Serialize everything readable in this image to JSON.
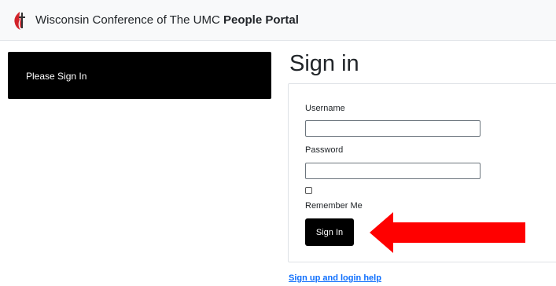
{
  "header": {
    "brand_prefix": "Wisconsin Conference of The UMC",
    "brand_bold": "People Portal",
    "logo_icon": "cross-and-flame-icon"
  },
  "sidebar": {
    "message": "Please Sign In"
  },
  "main": {
    "title": "Sign in",
    "form": {
      "username_label": "Username",
      "username_value": "",
      "password_label": "Password",
      "password_value": "",
      "remember_checked": false,
      "remember_label": "Remember Me",
      "submit_label": "Sign In"
    },
    "help_link": "Sign up and login help"
  },
  "annotation": {
    "arrow_icon": "red-arrow-pointing-left-icon",
    "arrow_color": "#ff0000"
  },
  "colors": {
    "accent_dark": "#000000",
    "link": "#0d6efd",
    "logo_red": "#d2232a"
  }
}
